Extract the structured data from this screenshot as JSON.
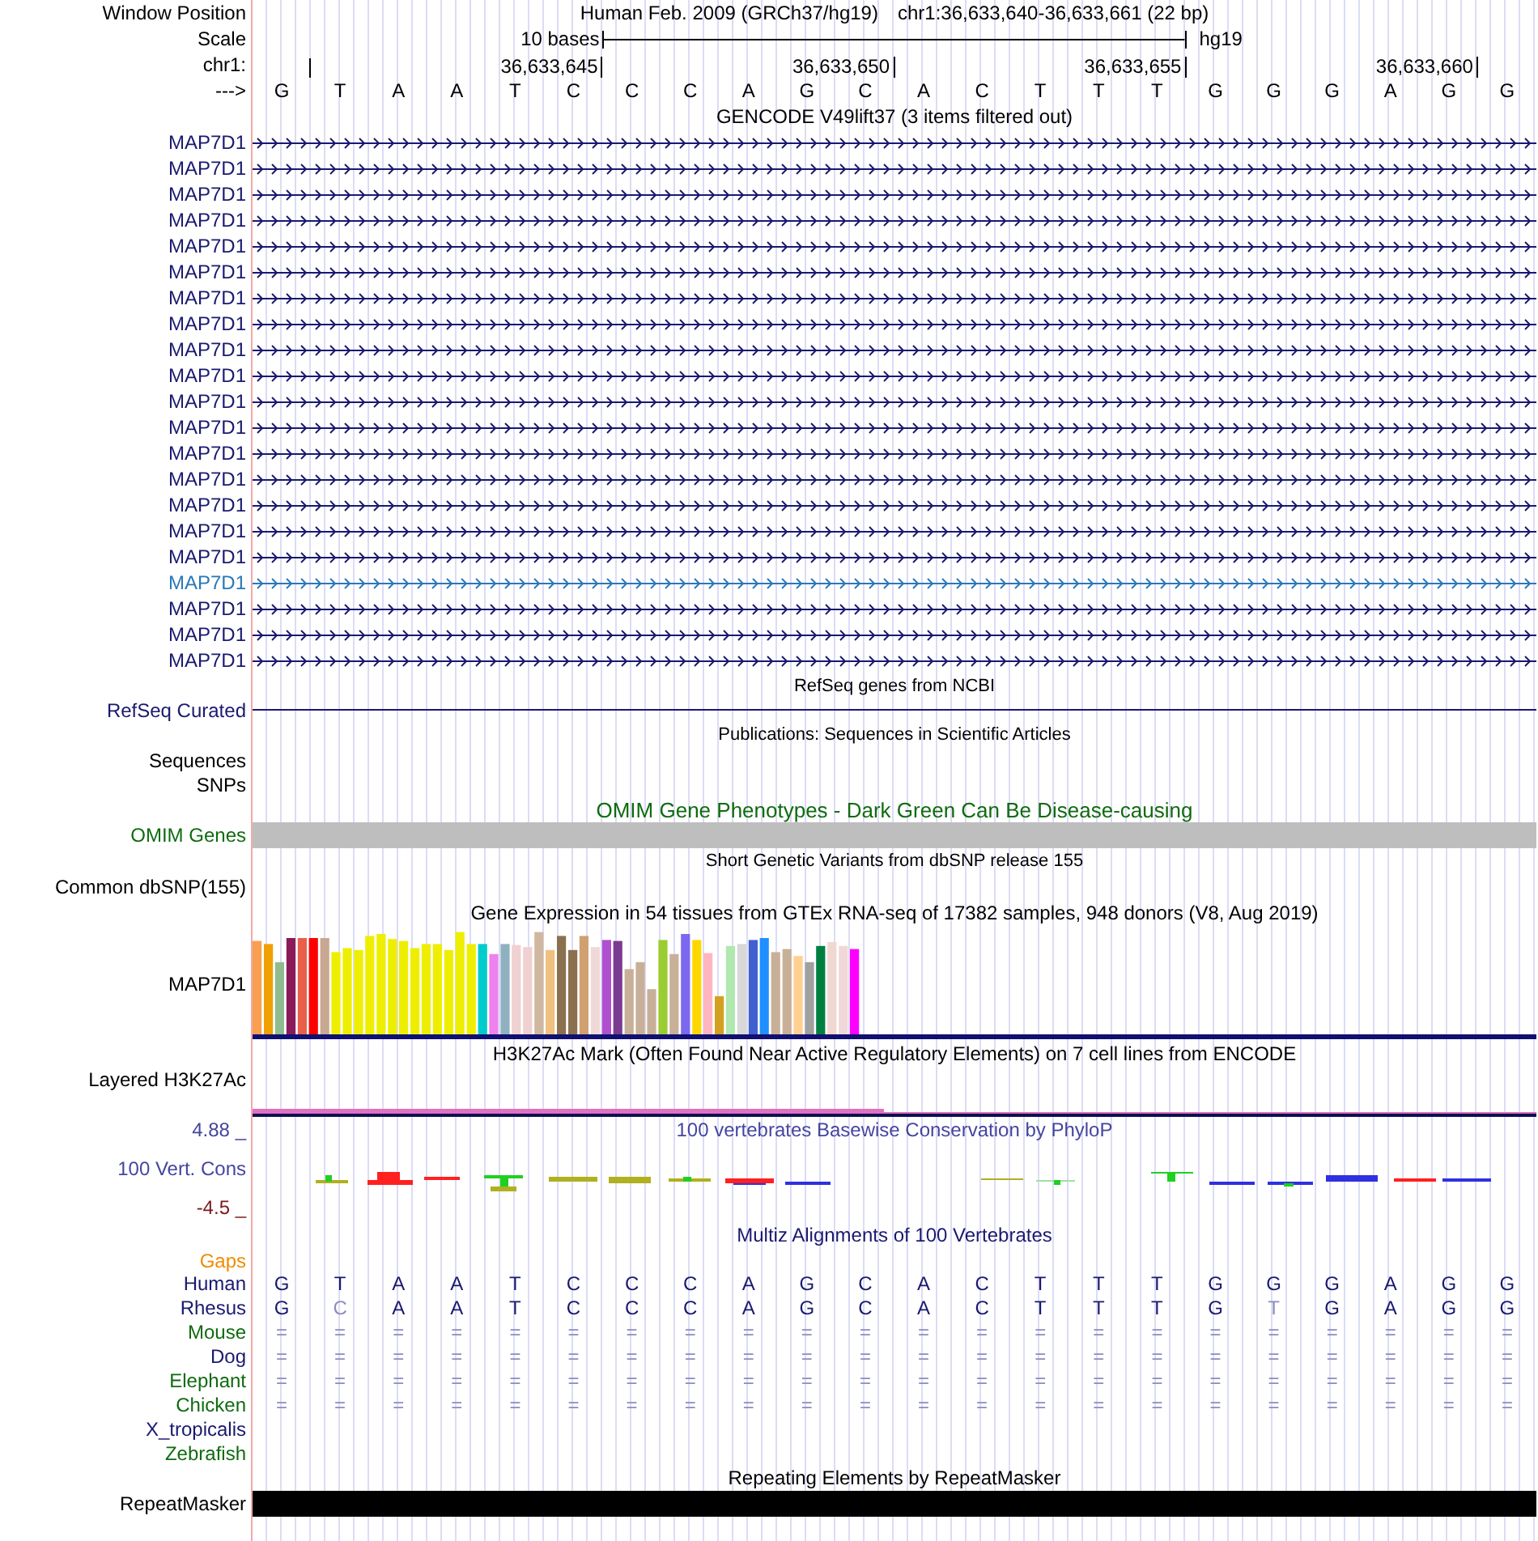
{
  "header": {
    "label": "Window Position",
    "assembly": "Human Feb. 2009 (GRCh37/hg19)",
    "position": "chr1:36,633,640-36,633,661 (22 bp)"
  },
  "scale": {
    "label": "Scale",
    "span": "10 bases",
    "db": "hg19"
  },
  "ruler": {
    "label": "chr1:",
    "ticks": [
      "36,633,645",
      "36,633,650",
      "36,633,655",
      "36,633,660"
    ]
  },
  "sequence": {
    "label": "--->",
    "bases": [
      "G",
      "T",
      "A",
      "A",
      "T",
      "C",
      "C",
      "C",
      "A",
      "G",
      "C",
      "A",
      "C",
      "T",
      "T",
      "T",
      "G",
      "G",
      "G",
      "A",
      "G",
      "G"
    ]
  },
  "gencode": {
    "title": "GENCODE V49lift37 (3 items filtered out)",
    "items": [
      {
        "name": "MAP7D1",
        "color": "#191970"
      },
      {
        "name": "MAP7D1",
        "color": "#191970"
      },
      {
        "name": "MAP7D1",
        "color": "#191970"
      },
      {
        "name": "MAP7D1",
        "color": "#191970"
      },
      {
        "name": "MAP7D1",
        "color": "#191970"
      },
      {
        "name": "MAP7D1",
        "color": "#191970"
      },
      {
        "name": "MAP7D1",
        "color": "#191970"
      },
      {
        "name": "MAP7D1",
        "color": "#191970"
      },
      {
        "name": "MAP7D1",
        "color": "#191970"
      },
      {
        "name": "MAP7D1",
        "color": "#191970"
      },
      {
        "name": "MAP7D1",
        "color": "#191970"
      },
      {
        "name": "MAP7D1",
        "color": "#191970"
      },
      {
        "name": "MAP7D1",
        "color": "#191970"
      },
      {
        "name": "MAP7D1",
        "color": "#191970"
      },
      {
        "name": "MAP7D1",
        "color": "#191970"
      },
      {
        "name": "MAP7D1",
        "color": "#191970"
      },
      {
        "name": "MAP7D1",
        "color": "#191970"
      },
      {
        "name": "MAP7D1",
        "color": "#2a78b8"
      },
      {
        "name": "MAP7D1",
        "color": "#191970"
      },
      {
        "name": "MAP7D1",
        "color": "#191970"
      },
      {
        "name": "MAP7D1",
        "color": "#191970"
      }
    ]
  },
  "refseq": {
    "title": "RefSeq genes from NCBI",
    "label": "RefSeq Curated"
  },
  "publications": {
    "title": "Publications: Sequences in Scientific Articles",
    "labels": [
      "Sequences",
      "SNPs"
    ]
  },
  "omim": {
    "title": "OMIM Gene Phenotypes - Dark Green Can Be Disease-causing",
    "label": "OMIM Genes"
  },
  "dbsnp": {
    "title": "Short Genetic Variants from dbSNP release 155",
    "label": "Common dbSNP(155)"
  },
  "gtex": {
    "title": "Gene Expression in 54 tissues from GTEx RNA-seq of 17382 samples, 948 donors (V8, Aug 2019)",
    "label": "MAP7D1"
  },
  "h3k27ac": {
    "title": "H3K27Ac Mark (Often Found Near Active Regulatory Elements) on 7 cell lines from ENCODE",
    "label": "Layered H3K27Ac"
  },
  "phylop": {
    "title": "100 vertebrates Basewise Conservation by PhyloP",
    "label": "100 Vert. Cons",
    "max": "4.88 _",
    "min": "-4.5 _"
  },
  "multiz": {
    "title": "Multiz Alignments of 100 Vertebrates",
    "gaps_label": "Gaps",
    "species": [
      {
        "name": "Human",
        "color": "#191970",
        "bases": [
          "G",
          "T",
          "A",
          "A",
          "T",
          "C",
          "C",
          "C",
          "A",
          "G",
          "C",
          "A",
          "C",
          "T",
          "T",
          "T",
          "G",
          "G",
          "G",
          "A",
          "G",
          "G"
        ],
        "faded": [
          false,
          false,
          false,
          false,
          false,
          false,
          false,
          false,
          false,
          false,
          false,
          false,
          false,
          false,
          false,
          false,
          false,
          false,
          false,
          false,
          false,
          false
        ]
      },
      {
        "name": "Rhesus",
        "color": "#191970",
        "bases": [
          "G",
          "C",
          "A",
          "A",
          "T",
          "C",
          "C",
          "C",
          "A",
          "G",
          "C",
          "A",
          "C",
          "T",
          "T",
          "T",
          "G",
          "T",
          "G",
          "A",
          "G",
          "G"
        ],
        "faded": [
          false,
          true,
          false,
          false,
          false,
          false,
          false,
          false,
          false,
          false,
          false,
          false,
          false,
          false,
          false,
          false,
          false,
          true,
          false,
          false,
          false,
          false
        ]
      },
      {
        "name": "Mouse",
        "color": "#0f6b0f",
        "bases": [
          "=",
          "=",
          "=",
          "=",
          "=",
          "=",
          "=",
          "=",
          "=",
          "=",
          "=",
          "=",
          "=",
          "=",
          "=",
          "=",
          "=",
          "=",
          "=",
          "=",
          "=",
          "="
        ],
        "faded": [
          true,
          true,
          true,
          true,
          true,
          true,
          true,
          true,
          true,
          true,
          true,
          true,
          true,
          true,
          true,
          true,
          true,
          true,
          true,
          true,
          true,
          true
        ]
      },
      {
        "name": "Dog",
        "color": "#191970",
        "bases": [
          "=",
          "=",
          "=",
          "=",
          "=",
          "=",
          "=",
          "=",
          "=",
          "=",
          "=",
          "=",
          "=",
          "=",
          "=",
          "=",
          "=",
          "=",
          "=",
          "=",
          "=",
          "="
        ],
        "faded": [
          true,
          true,
          true,
          true,
          true,
          true,
          true,
          true,
          true,
          true,
          true,
          true,
          true,
          true,
          true,
          true,
          true,
          true,
          true,
          true,
          true,
          true
        ]
      },
      {
        "name": "Elephant",
        "color": "#0f6b0f",
        "bases": [
          "=",
          "=",
          "=",
          "=",
          "=",
          "=",
          "=",
          "=",
          "=",
          "=",
          "=",
          "=",
          "=",
          "=",
          "=",
          "=",
          "=",
          "=",
          "=",
          "=",
          "=",
          "="
        ],
        "faded": [
          true,
          true,
          true,
          true,
          true,
          true,
          true,
          true,
          true,
          true,
          true,
          true,
          true,
          true,
          true,
          true,
          true,
          true,
          true,
          true,
          true,
          true
        ]
      },
      {
        "name": "Chicken",
        "color": "#0f6b0f",
        "bases": [
          "=",
          "=",
          "=",
          "=",
          "=",
          "=",
          "=",
          "=",
          "=",
          "=",
          "=",
          "=",
          "=",
          "=",
          "=",
          "=",
          "=",
          "=",
          "=",
          "=",
          "=",
          "="
        ],
        "faded": [
          true,
          true,
          true,
          true,
          true,
          true,
          true,
          true,
          true,
          true,
          true,
          true,
          true,
          true,
          true,
          true,
          true,
          true,
          true,
          true,
          true,
          true
        ]
      },
      {
        "name": "X_tropicalis",
        "color": "#191970"
      },
      {
        "name": "Zebrafish",
        "color": "#0f6b0f"
      }
    ]
  },
  "repeatmasker": {
    "title": "Repeating Elements by RepeatMasker",
    "label": "RepeatMasker"
  }
}
